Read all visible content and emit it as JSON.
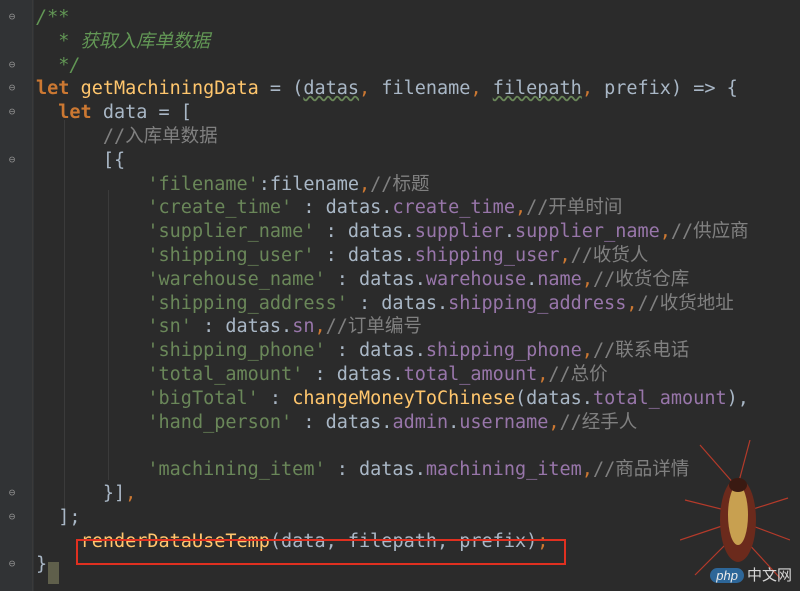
{
  "editor": {
    "lines": [
      [
        {
          "t": "/**",
          "c": "doc"
        }
      ],
      [
        {
          "t": "  * 获取入库单数据",
          "c": "doc"
        }
      ],
      [
        {
          "t": "  */",
          "c": "doc"
        }
      ],
      [
        {
          "t": "let",
          "c": "kw"
        },
        {
          "t": " ",
          "c": ""
        },
        {
          "t": "getMachiningData",
          "c": "fn"
        },
        {
          "t": " = (",
          "c": ""
        },
        {
          "t": "datas",
          "c": "squig"
        },
        {
          "t": ", ",
          "c": "punc"
        },
        {
          "t": "filename",
          "c": ""
        },
        {
          "t": ", ",
          "c": "punc"
        },
        {
          "t": "filepath",
          "c": "squig"
        },
        {
          "t": ", ",
          "c": "punc"
        },
        {
          "t": "prefix",
          "c": ""
        },
        {
          "t": ") => {",
          "c": ""
        }
      ],
      [
        {
          "t": "  ",
          "c": ""
        },
        {
          "t": "let",
          "c": "kw"
        },
        {
          "t": " data = [",
          "c": ""
        }
      ],
      [
        {
          "t": "      ",
          "c": ""
        },
        {
          "t": "//入库单数据",
          "c": "cmt"
        }
      ],
      [
        {
          "t": "      [{",
          "c": ""
        }
      ],
      [
        {
          "t": "          ",
          "c": ""
        },
        {
          "t": "'filename'",
          "c": "str"
        },
        {
          "t": ":filename",
          "c": ""
        },
        {
          "t": ",",
          "c": "punc"
        },
        {
          "t": "//标题",
          "c": "cmt"
        }
      ],
      [
        {
          "t": "          ",
          "c": ""
        },
        {
          "t": "'create_time'",
          "c": "str"
        },
        {
          "t": " : datas.",
          "c": ""
        },
        {
          "t": "create_time",
          "c": "prop"
        },
        {
          "t": ",",
          "c": "punc"
        },
        {
          "t": "//开单时间",
          "c": "cmt"
        }
      ],
      [
        {
          "t": "          ",
          "c": ""
        },
        {
          "t": "'supplier_name'",
          "c": "str"
        },
        {
          "t": " : datas.",
          "c": ""
        },
        {
          "t": "supplier",
          "c": "prop"
        },
        {
          "t": ".",
          "c": ""
        },
        {
          "t": "supplier_name",
          "c": "prop"
        },
        {
          "t": ",",
          "c": "punc"
        },
        {
          "t": "//供应商",
          "c": "cmt"
        }
      ],
      [
        {
          "t": "          ",
          "c": ""
        },
        {
          "t": "'shipping_user'",
          "c": "str"
        },
        {
          "t": " : datas.",
          "c": ""
        },
        {
          "t": "shipping_user",
          "c": "prop"
        },
        {
          "t": ",",
          "c": "punc"
        },
        {
          "t": "//收货人",
          "c": "cmt"
        }
      ],
      [
        {
          "t": "          ",
          "c": ""
        },
        {
          "t": "'warehouse_name'",
          "c": "str"
        },
        {
          "t": " : datas.",
          "c": ""
        },
        {
          "t": "warehouse",
          "c": "prop"
        },
        {
          "t": ".",
          "c": ""
        },
        {
          "t": "name",
          "c": "prop"
        },
        {
          "t": ",",
          "c": "punc"
        },
        {
          "t": "//收货仓库",
          "c": "cmt"
        }
      ],
      [
        {
          "t": "          ",
          "c": ""
        },
        {
          "t": "'shipping_address'",
          "c": "str"
        },
        {
          "t": " : datas.",
          "c": ""
        },
        {
          "t": "shipping_address",
          "c": "prop"
        },
        {
          "t": ",",
          "c": "punc"
        },
        {
          "t": "//收货地址",
          "c": "cmt"
        }
      ],
      [
        {
          "t": "          ",
          "c": ""
        },
        {
          "t": "'sn'",
          "c": "str"
        },
        {
          "t": " : datas.",
          "c": ""
        },
        {
          "t": "sn",
          "c": "prop"
        },
        {
          "t": ",",
          "c": "punc"
        },
        {
          "t": "//订单编号",
          "c": "cmt"
        }
      ],
      [
        {
          "t": "          ",
          "c": ""
        },
        {
          "t": "'shipping_phone'",
          "c": "str"
        },
        {
          "t": " : datas.",
          "c": ""
        },
        {
          "t": "shipping_phone",
          "c": "prop"
        },
        {
          "t": ",",
          "c": "punc"
        },
        {
          "t": "//联系电话",
          "c": "cmt"
        }
      ],
      [
        {
          "t": "          ",
          "c": ""
        },
        {
          "t": "'total_amount'",
          "c": "str"
        },
        {
          "t": " : datas.",
          "c": ""
        },
        {
          "t": "total_amount",
          "c": "prop"
        },
        {
          "t": ",",
          "c": "punc"
        },
        {
          "t": "//总价",
          "c": "cmt"
        }
      ],
      [
        {
          "t": "          ",
          "c": ""
        },
        {
          "t": "'bigTotal'",
          "c": "str"
        },
        {
          "t": " : ",
          "c": ""
        },
        {
          "t": "changeMoneyToChinese",
          "c": "fn"
        },
        {
          "t": "(datas.",
          "c": ""
        },
        {
          "t": "total_amount",
          "c": "prop"
        },
        {
          "t": "),",
          "c": ""
        }
      ],
      [
        {
          "t": "          ",
          "c": ""
        },
        {
          "t": "'hand_person'",
          "c": "str"
        },
        {
          "t": " : datas.",
          "c": ""
        },
        {
          "t": "admin",
          "c": "prop"
        },
        {
          "t": ".",
          "c": ""
        },
        {
          "t": "username",
          "c": "prop"
        },
        {
          "t": ",",
          "c": "punc"
        },
        {
          "t": "//经手人",
          "c": "cmt"
        }
      ],
      [],
      [
        {
          "t": "          ",
          "c": ""
        },
        {
          "t": "'machining_item'",
          "c": "str"
        },
        {
          "t": " : datas.",
          "c": ""
        },
        {
          "t": "machining_item",
          "c": "prop"
        },
        {
          "t": ",",
          "c": "punc"
        },
        {
          "t": "//商品详情",
          "c": "cmt"
        }
      ],
      [
        {
          "t": "      }]",
          "c": ""
        },
        {
          "t": ",",
          "c": "punc"
        }
      ],
      [
        {
          "t": "  ];",
          "c": ""
        }
      ],
      [
        {
          "t": "    ",
          "c": ""
        },
        {
          "t": "renderDataUseTemp",
          "c": "fn"
        },
        {
          "t": "(data, filepath, prefix)",
          "c": ""
        },
        {
          "t": ";",
          "c": "punc"
        }
      ],
      [
        {
          "t": "}",
          "c": ""
        }
      ]
    ],
    "fold_markers": {
      "0": "⊖",
      "2": "⊖",
      "3": "⊖",
      "4": "⊖",
      "6": "⊖",
      "20": "⊖",
      "21": "⊖",
      "23": "⊖"
    }
  },
  "watermark": {
    "badge": "php",
    "text": "中文网"
  },
  "colors": {
    "background": "#2b2b2b",
    "highlight_border": "#e03020",
    "keyword": "#cc7832",
    "function": "#ffc66d",
    "string": "#6a8759",
    "property": "#9876aa",
    "comment": "#808080"
  }
}
